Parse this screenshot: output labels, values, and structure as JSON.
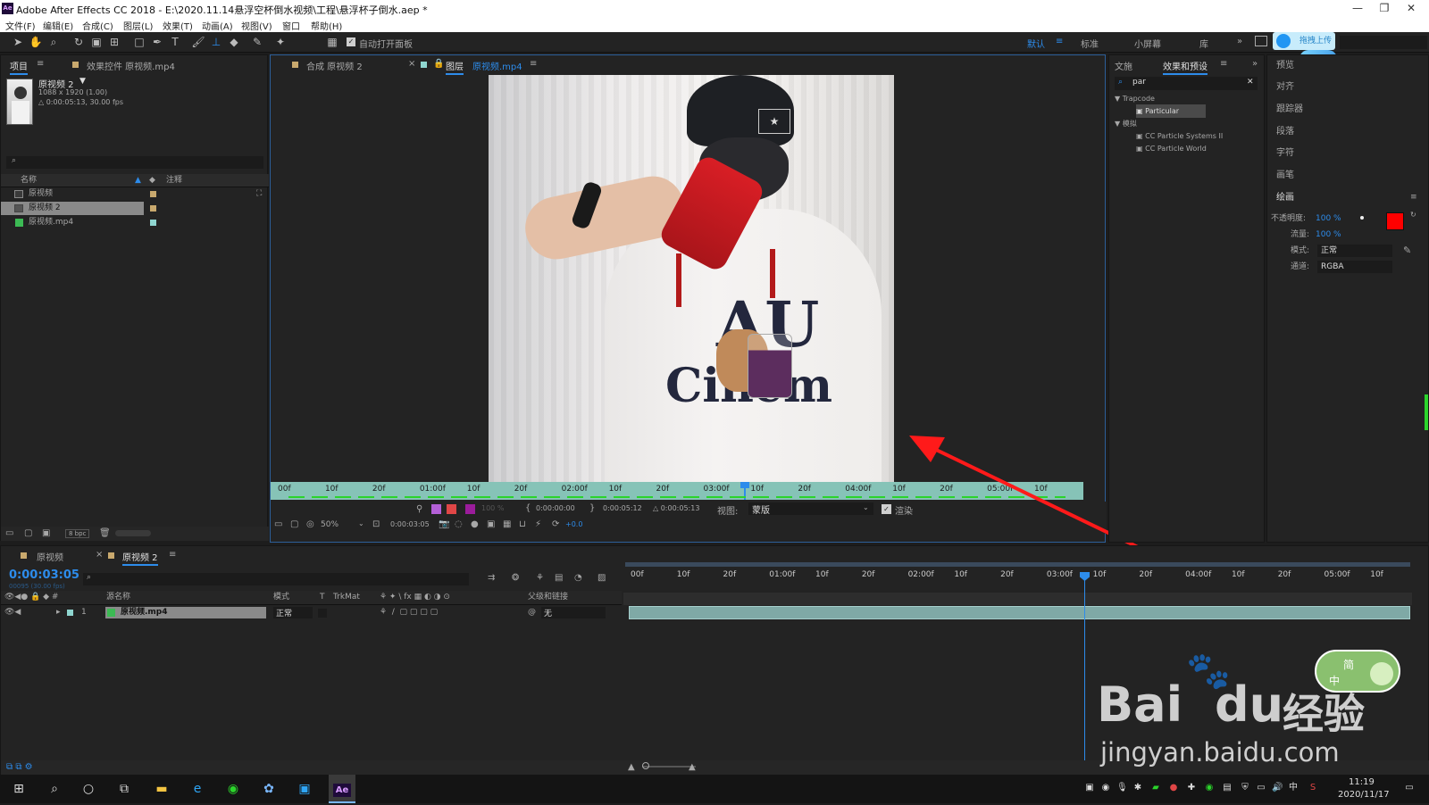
{
  "titlebar": {
    "title": "Adobe After Effects CC 2018 - E:\\2020.11.14悬浮空杯倒水视频\\工程\\悬浮杯子倒水.aep *",
    "app_icon": "Ae"
  },
  "menu": [
    "文件(F)",
    "编辑(E)",
    "合成(C)",
    "图层(L)",
    "效果(T)",
    "动画(A)",
    "视图(V)",
    "窗口",
    "帮助(H)"
  ],
  "toolbar": {
    "auto_open_label": "自动打开面板",
    "workspaces": [
      "默认",
      "标准",
      "小屏幕",
      "库"
    ],
    "upload_button": "拖拽上传"
  },
  "project_panel": {
    "tabs": [
      "项目",
      "效果控件 原视频.mp4"
    ],
    "preview": {
      "name": "原视频 2",
      "size": "1088 x 1920 (1.00)",
      "duration": "△ 0:00:05:13, 30.00 fps"
    },
    "columns": [
      "名称",
      "注释"
    ],
    "items": [
      {
        "name": "原视频",
        "color": "#c9a96e"
      },
      {
        "name": "原视频 2",
        "color": "#c9a96e"
      },
      {
        "name": "原视频.mp4",
        "color": "#8fd6d0"
      }
    ],
    "bpc": "8 bpc"
  },
  "viewer": {
    "tabs": [
      "合成 原视频 2",
      "图层",
      "原视频.mp4"
    ],
    "ruler_ticks": [
      "00f",
      "10f",
      "20f",
      "01:00f",
      "10f",
      "20f",
      "02:00f",
      "10f",
      "20f",
      "03:00f",
      "10f",
      "20f",
      "04:00f",
      "10f",
      "20f",
      "05:00f",
      "10f"
    ],
    "in_time": "0:00:00:00",
    "out_time": "0:00:05:12",
    "duration": "△ 0:00:05:13",
    "view_label": "视图:",
    "view_value": "蒙版",
    "render_label": "渲染",
    "opacity": "100 %",
    "zoom": "50%",
    "current_time": "0:00:03:05",
    "exposure": "+0.0",
    "shirt_text1": "AU",
    "shirt_text2": "Cinem"
  },
  "effects_panel": {
    "tabs": [
      "文施",
      "效果和预设"
    ],
    "search": "par",
    "groups": [
      {
        "name": "Trapcode",
        "items": [
          "Particular"
        ]
      },
      {
        "name": "模拟",
        "items": [
          "CC Particle Systems II",
          "CC Particle World"
        ]
      }
    ]
  },
  "right_panel": {
    "items": [
      "预览",
      "对齐",
      "跟踪器",
      "段落",
      "字符",
      "画笔"
    ],
    "brush_header": "绘画",
    "opacity_label": "不透明度:",
    "opacity_value": "100 %",
    "flow_label": "流量:",
    "flow_value": "100 %",
    "mode_label": "模式:",
    "mode_value": "正常",
    "channel_label": "通道:",
    "channel_value": "RGBA",
    "fg_color": "#ff0000",
    "bg_color": "#ffffff"
  },
  "timeline": {
    "tabs": [
      "原视频",
      "原视频 2"
    ],
    "current_time": "0:00:03:05",
    "frame_info": "00095 (30.00 fps)",
    "columns": [
      "源名称",
      "模式",
      "T",
      "TrkMat",
      "父级和链接"
    ],
    "layers": [
      {
        "index": "1",
        "name": "原视频.mp4",
        "mode": "正常",
        "parent": "无"
      }
    ],
    "ruler_ticks": [
      "00f",
      "10f",
      "20f",
      "01:00f",
      "10f",
      "20f",
      "02:00f",
      "10f",
      "20f",
      "03:00f",
      "10f",
      "20f",
      "04:00f",
      "10f",
      "20f",
      "05:00f",
      "10f"
    ]
  },
  "watermark": {
    "brand": "Bai",
    "brand2": "du",
    "cn": "经验",
    "url": "jingyan.baidu.com"
  },
  "ime": {
    "top": "简",
    "bottom": "中"
  },
  "taskbar": {
    "time": "11:19",
    "date": "2020/11/17",
    "ime": "中"
  }
}
